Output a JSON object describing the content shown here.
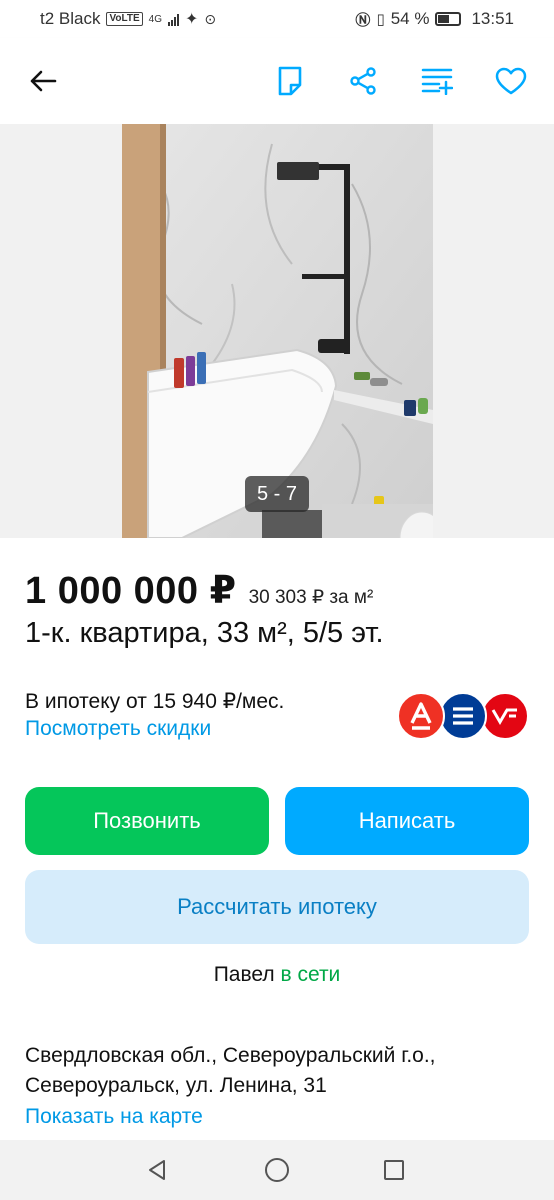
{
  "status_bar": {
    "carrier": "t2 Black",
    "volte": "VoLTE",
    "network": "4G",
    "battery": "54 %",
    "time": "13:51"
  },
  "toolbar": {
    "back_icon": "arrow-left-icon",
    "note_icon": "note-icon",
    "share_icon": "share-icon",
    "compare_icon": "compare-list-icon",
    "favorite_icon": "heart-icon",
    "accent_color": "#00aaff"
  },
  "gallery": {
    "counter": "5 - 7"
  },
  "listing": {
    "price": "1 000 000 ₽",
    "price_per_m2": "30 303 ₽ за м²",
    "title": "1-к. квартира, 33 м², 5/5 эт."
  },
  "mortgage": {
    "text": "В ипотеку от 15 940 ₽/мес.",
    "link": "Посмотреть скидки",
    "banks": [
      {
        "name": "Альфа-Банк",
        "letter": "А",
        "color": "#ef3124"
      },
      {
        "name": "bank-2",
        "letter": "",
        "color": "#003c96"
      },
      {
        "name": "bank-3",
        "letter": "",
        "color": "#e30613"
      }
    ]
  },
  "actions": {
    "call": "Позвонить",
    "write": "Написать",
    "calc_mortgage": "Рассчитать ипотеку"
  },
  "seller": {
    "name": "Павел",
    "status": "в сети"
  },
  "location": {
    "address_line1": "Свердловская обл., Североуральский г.о.,",
    "address_line2": "Североуральск, ул. Ленина, 31",
    "map_link": "Показать на карте"
  },
  "navbar": {
    "back": "triangle-back-icon",
    "home": "circle-home-icon",
    "recents": "square-recents-icon"
  }
}
